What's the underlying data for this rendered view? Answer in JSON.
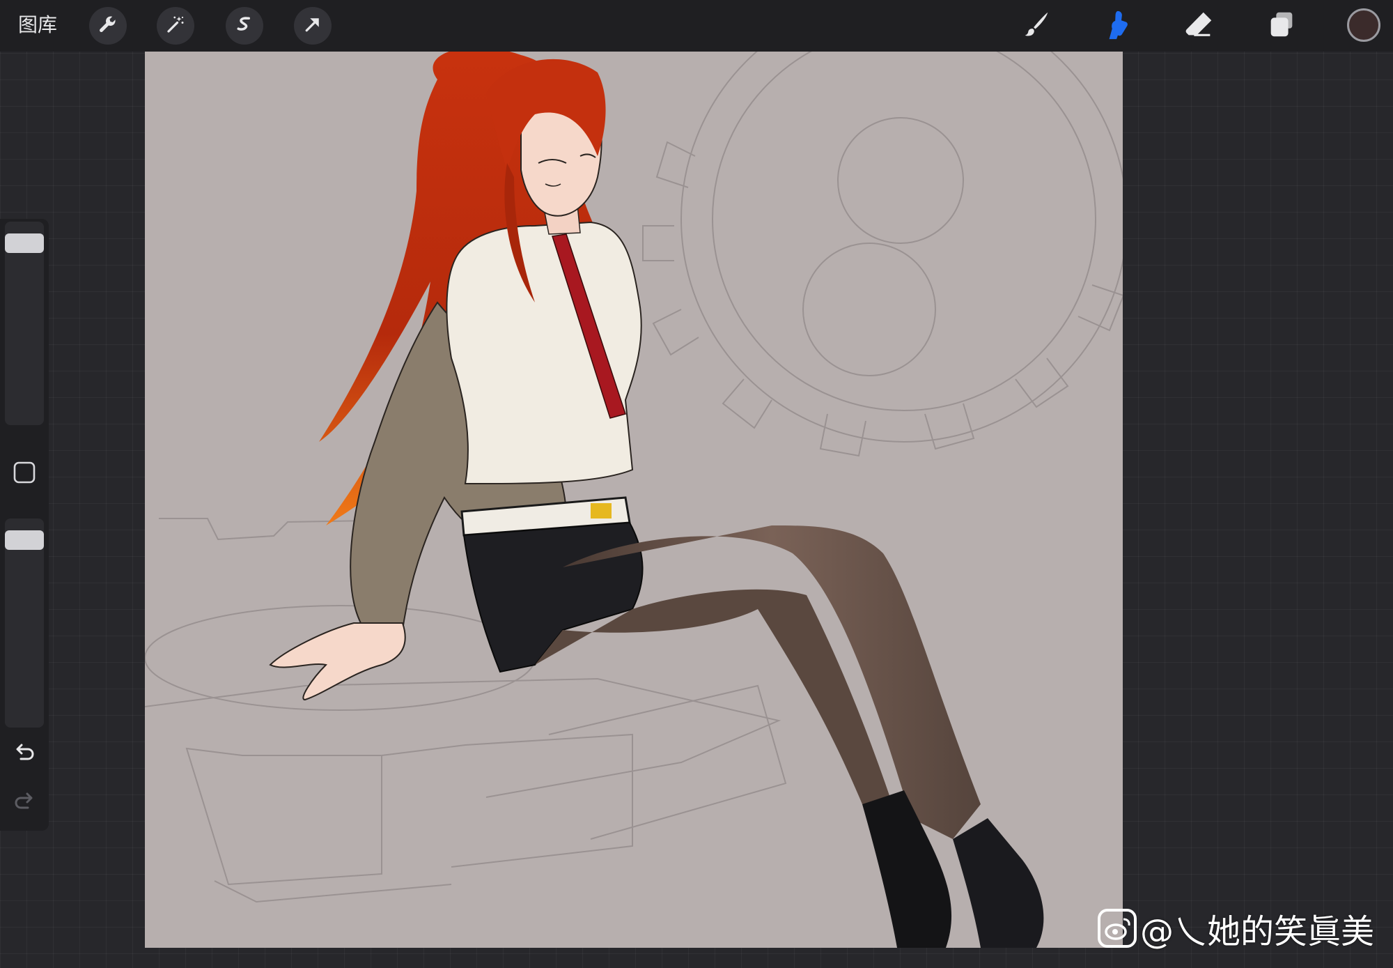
{
  "toolbar": {
    "gallery_label": "图库",
    "left_tools": [
      "wrench-icon",
      "magic-wand-icon",
      "selection-icon",
      "transform-arrow-icon"
    ],
    "right_tools": [
      "brush-icon",
      "smudge-icon",
      "eraser-icon",
      "layers-icon"
    ],
    "active_tool": "smudge-icon",
    "accent_color": "#1e6cf0",
    "current_color": "#3b2b2b"
  },
  "sidebar": {
    "brush_size_level": 0.95,
    "opacity_level": 0.95,
    "icons": [
      "modify-square-icon",
      "undo-icon",
      "redo-icon"
    ]
  },
  "canvas": {
    "background_color": "#b7afae",
    "subject": "anime-girl-illustration"
  },
  "watermark": {
    "text": "@乀她的笑眞美"
  }
}
